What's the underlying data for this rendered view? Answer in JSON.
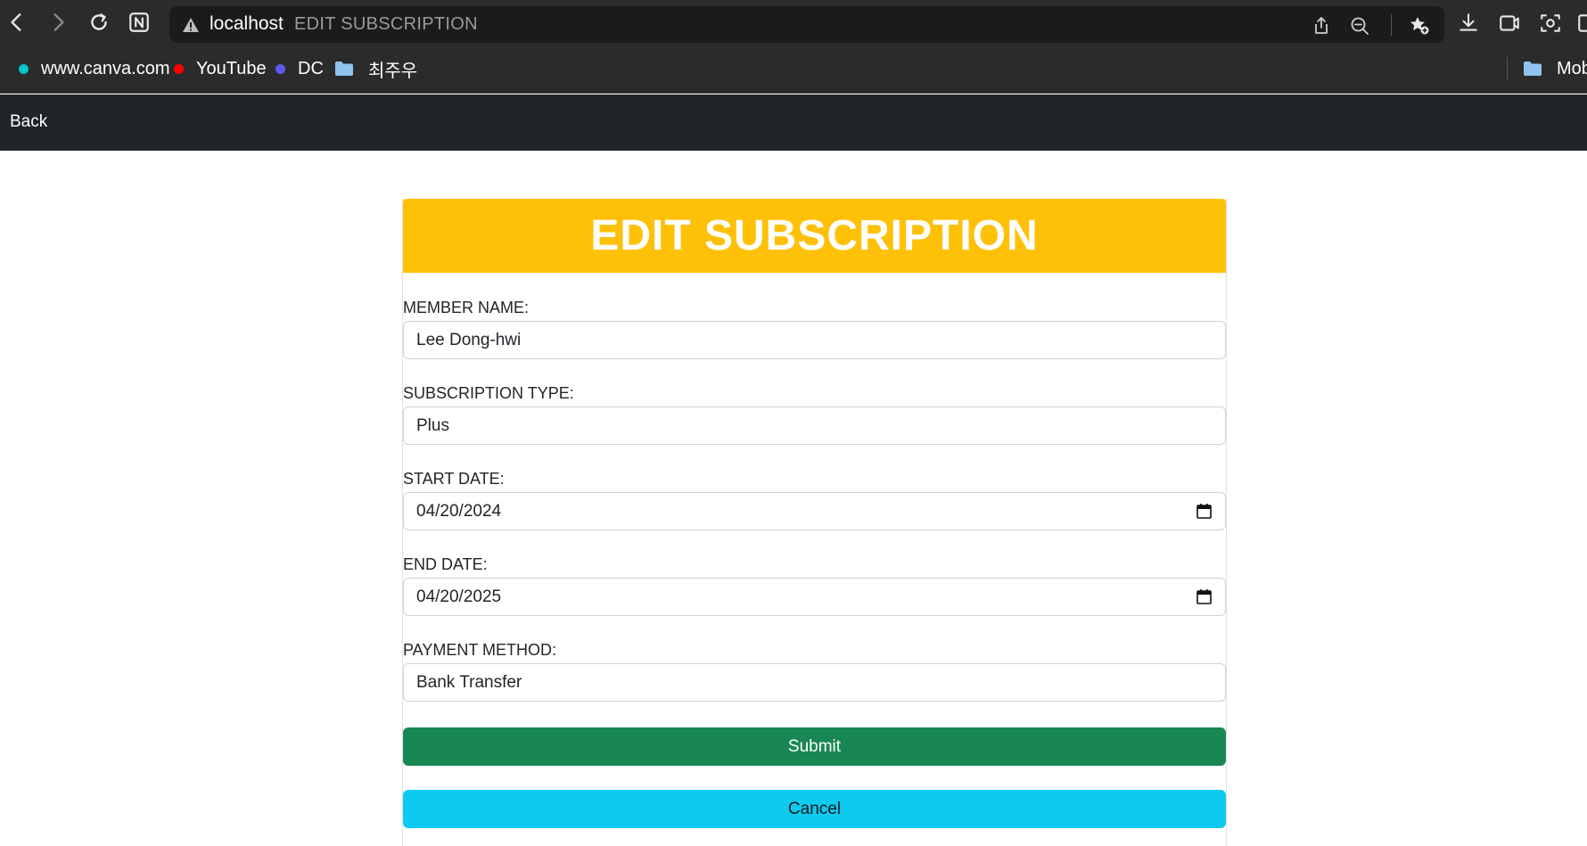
{
  "browser": {
    "host": "localhost",
    "page_title": "EDIT SUBSCRIPTION",
    "bookmarks": [
      {
        "label": "www.canva.com",
        "icon": "canva-dot-icon",
        "color": "#00c4cc"
      },
      {
        "label": "YouTube",
        "icon": "youtube-dot-icon",
        "color": "#ff0000"
      },
      {
        "label": "DC",
        "icon": "dc-dot-icon",
        "color": "#5b5bf0"
      },
      {
        "label": "최주우",
        "icon": "folder-icon"
      }
    ],
    "right_bookmark": {
      "label": "Mobi",
      "icon": "folder-icon"
    }
  },
  "app_nav": {
    "back_label": "Back"
  },
  "form": {
    "title": "EDIT SUBSCRIPTION",
    "header_color": "#ffc107",
    "fields": [
      {
        "label": "MEMBER NAME:",
        "value": "Lee Dong-hwi",
        "type": "text"
      },
      {
        "label": "SUBSCRIPTION TYPE:",
        "value": "Plus",
        "type": "text"
      },
      {
        "label": "START DATE:",
        "value": "04/20/2024",
        "type": "date"
      },
      {
        "label": "END DATE:",
        "value": "04/20/2025",
        "type": "date"
      },
      {
        "label": "PAYMENT METHOD:",
        "value": "Bank Transfer",
        "type": "text"
      }
    ],
    "submit_label": "Submit",
    "submit_color": "#198754",
    "cancel_label": "Cancel",
    "cancel_color": "#0dcaf0"
  }
}
